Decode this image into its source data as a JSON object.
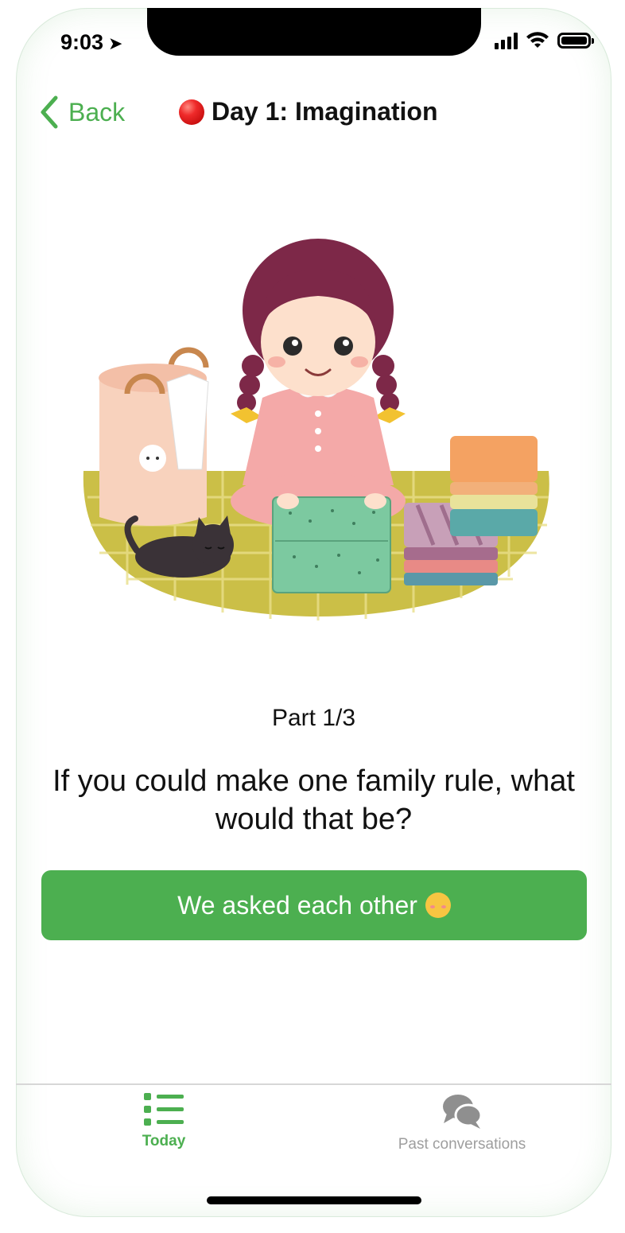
{
  "status_bar": {
    "time": "9:03"
  },
  "nav": {
    "back_label": "Back",
    "title": "Day 1: Imagination"
  },
  "content": {
    "part_label": "Part 1/3",
    "question": "If you could make one family rule, what would that be?",
    "cta_label": "We asked each other"
  },
  "tab_bar": {
    "tabs": [
      {
        "label": "Today",
        "icon": "list-icon",
        "active": true
      },
      {
        "label": "Past conversations",
        "icon": "chat-bubbles-icon",
        "active": false
      }
    ]
  },
  "colors": {
    "accent": "#4caf50",
    "inactive": "#9e9e9e"
  }
}
